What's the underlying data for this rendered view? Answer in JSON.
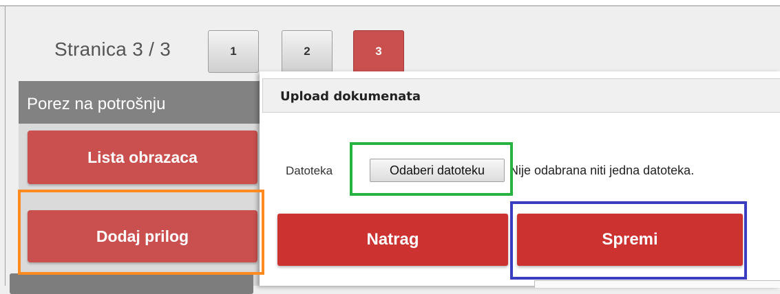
{
  "pager": {
    "label": "Stranica 3 / 3",
    "pages": [
      "1",
      "2",
      "3"
    ],
    "active_page": "3"
  },
  "left_panel": {
    "header": "Porez na potrošnju",
    "list_button": "Lista obrazaca",
    "add_button": "Dodaj prilog"
  },
  "dialog": {
    "title": "Upload dokumenata",
    "field_label": "Datoteka",
    "choose_file_button": "Odaberi datoteku",
    "no_file_text": "Nije odabrana niti jedna datoteka.",
    "back_button": "Natrag",
    "save_button": "Spremi"
  },
  "colors": {
    "pager_active": "#c9504f",
    "panel_button": "#c9504f",
    "action_button": "#cc3330",
    "highlight_green": "#27b341",
    "highlight_orange": "#ff8a1f",
    "highlight_blue": "#3b3dc0"
  }
}
